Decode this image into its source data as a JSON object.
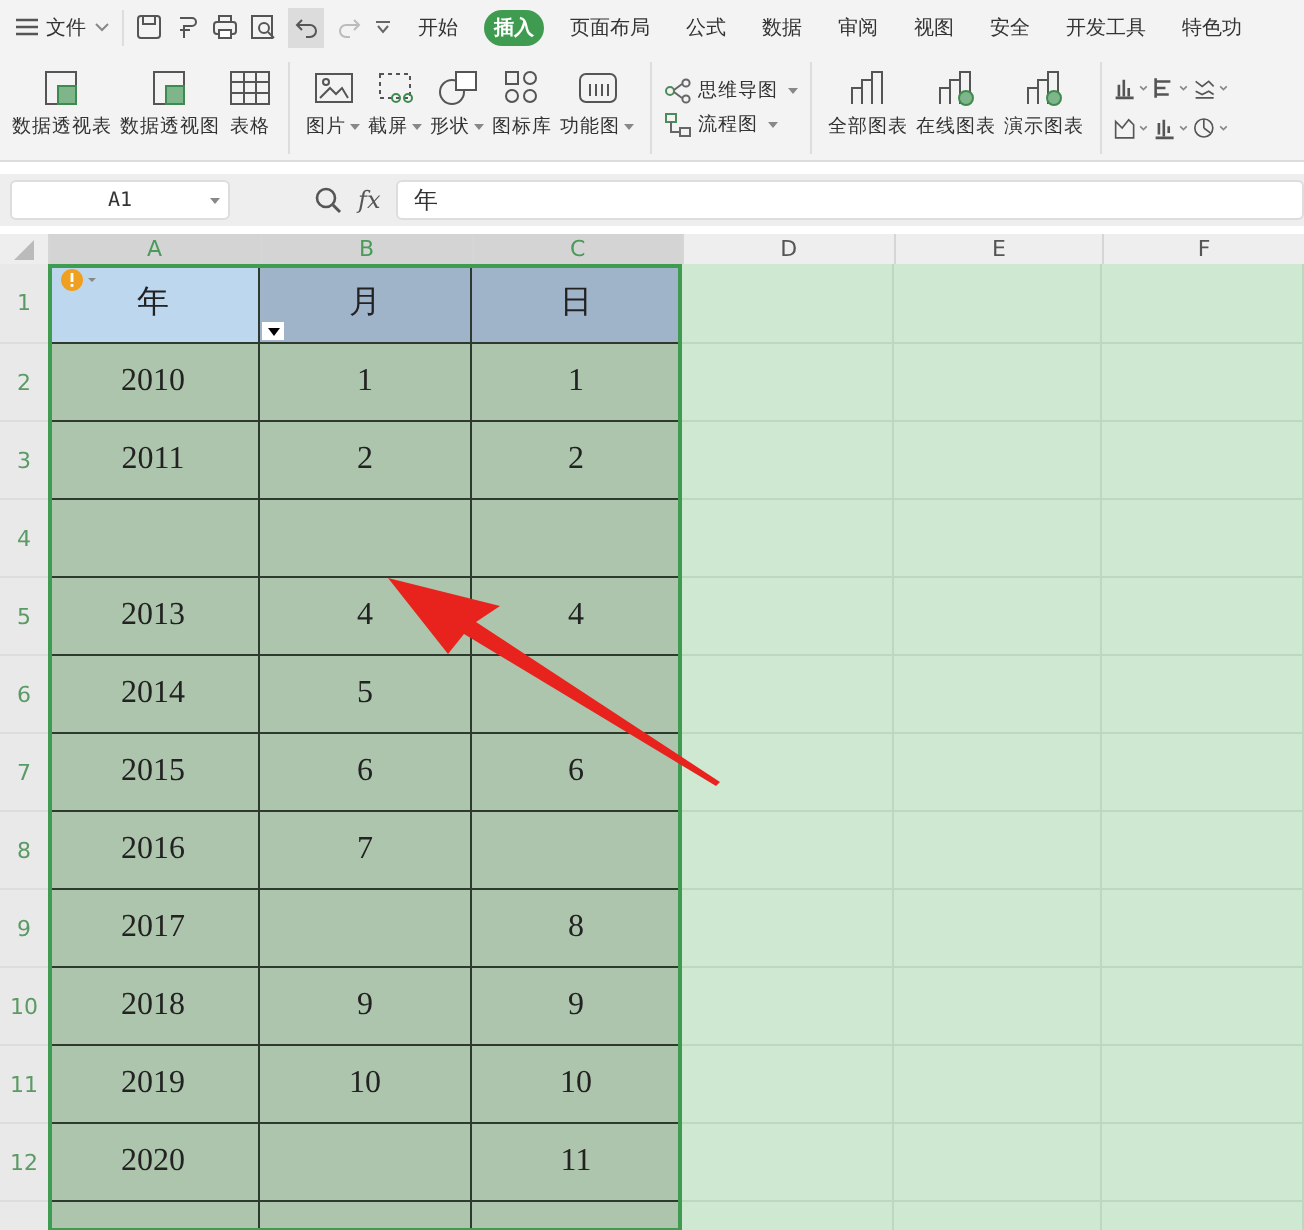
{
  "menu": {
    "label": "文件"
  },
  "tabs": [
    {
      "label": "开始",
      "selected": false
    },
    {
      "label": "插入",
      "selected": true
    },
    {
      "label": "页面布局",
      "selected": false
    },
    {
      "label": "公式",
      "selected": false
    },
    {
      "label": "数据",
      "selected": false
    },
    {
      "label": "审阅",
      "selected": false
    },
    {
      "label": "视图",
      "selected": false
    },
    {
      "label": "安全",
      "selected": false
    },
    {
      "label": "开发工具",
      "selected": false
    },
    {
      "label": "特色功",
      "selected": false
    }
  ],
  "ribbon": [
    [
      {
        "label": "数据透视表",
        "dropdown": false
      },
      {
        "label": "数据透视图",
        "dropdown": false
      },
      {
        "label": "表格",
        "dropdown": false
      }
    ],
    [
      {
        "label": "图片",
        "dropdown": true
      },
      {
        "label": "截屏",
        "dropdown": true
      },
      {
        "label": "形状",
        "dropdown": true
      },
      {
        "label": "图标库",
        "dropdown": false
      },
      {
        "label": "功能图",
        "dropdown": true
      }
    ],
    [
      {
        "label": "思维导图",
        "dropdown": true
      },
      {
        "label": "流程图",
        "dropdown": true
      }
    ],
    [
      {
        "label": "全部图表",
        "dropdown": false
      },
      {
        "label": "在线图表",
        "dropdown": false
      },
      {
        "label": "演示图表",
        "dropdown": false
      }
    ]
  ],
  "name_box": "A1",
  "fx_label": "fx",
  "formula": "年",
  "columns": [
    {
      "label": "A",
      "selected": true
    },
    {
      "label": "B",
      "selected": true
    },
    {
      "label": "C",
      "selected": true
    },
    {
      "label": "D",
      "selected": false
    },
    {
      "label": "E",
      "selected": false
    },
    {
      "label": "F",
      "selected": false
    }
  ],
  "rows": [
    {
      "number": "1",
      "cells": [
        "年",
        "月",
        "日"
      ]
    },
    {
      "number": "2",
      "cells": [
        "2010",
        "1",
        "1"
      ]
    },
    {
      "number": "3",
      "cells": [
        "2011",
        "2",
        "2"
      ]
    },
    {
      "number": "4",
      "cells": [
        "",
        "",
        ""
      ]
    },
    {
      "number": "5",
      "cells": [
        "2013",
        "4",
        "4"
      ]
    },
    {
      "number": "6",
      "cells": [
        "2014",
        "5",
        ""
      ]
    },
    {
      "number": "7",
      "cells": [
        "2015",
        "6",
        "6"
      ]
    },
    {
      "number": "8",
      "cells": [
        "2016",
        "7",
        ""
      ]
    },
    {
      "number": "9",
      "cells": [
        "2017",
        "",
        "8"
      ]
    },
    {
      "number": "10",
      "cells": [
        "2018",
        "9",
        "9"
      ]
    },
    {
      "number": "11",
      "cells": [
        "2019",
        "10",
        "10"
      ]
    },
    {
      "number": "12",
      "cells": [
        "2020",
        "",
        "11"
      ]
    }
  ]
}
